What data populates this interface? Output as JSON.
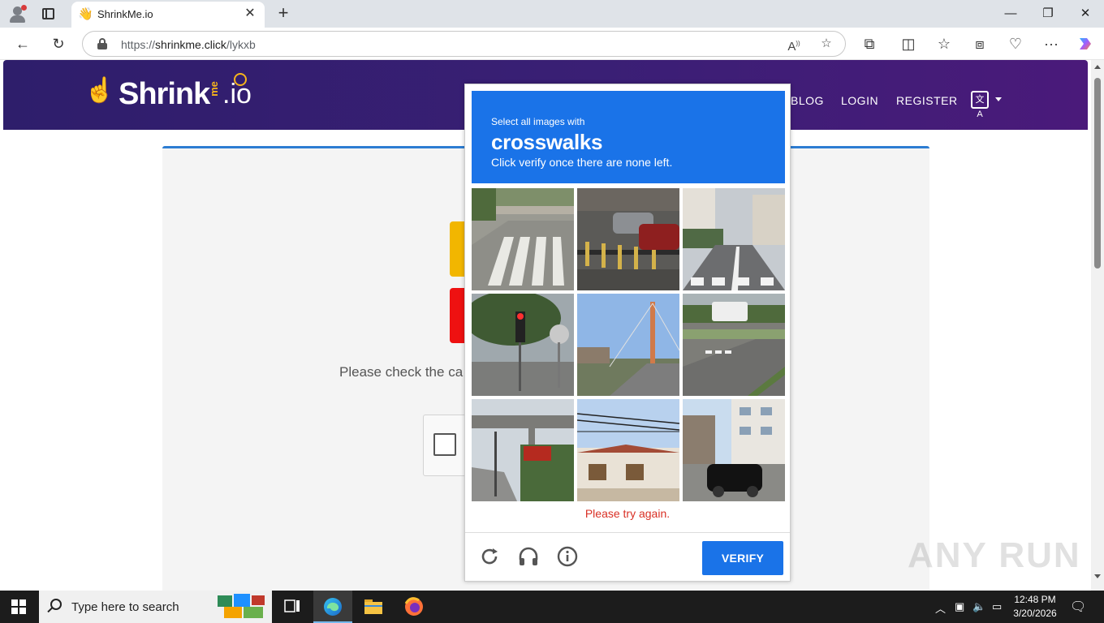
{
  "browser": {
    "tab_title": "ShrinkMe.io",
    "tab_favicon": "👋",
    "url_prefix": "https://",
    "url_host": "shrinkme.click",
    "url_path": "/lykxb"
  },
  "site": {
    "logo_text": "Shrink",
    "logo_me": "me",
    "logo_io": ".io",
    "nav": [
      "BLOG",
      "LOGIN",
      "REGISTER"
    ],
    "lang_icon_text": "文A"
  },
  "page": {
    "check_text": "Please check the ca"
  },
  "captcha": {
    "instruction_prefix": "Select all images with",
    "target": "crosswalks",
    "instruction_suffix": "Click verify once there are none left.",
    "tiles": [
      "crosswalk-street",
      "cars-parking-bollards",
      "bikes-road-crosswalk",
      "traffic-light-trees",
      "cable-bridge-road",
      "bus-road-crossing",
      "overpass-tractor",
      "house-power-lines",
      "black-car-building"
    ],
    "error": "Please try again.",
    "verify_label": "VERIFY"
  },
  "watermark": "ANY RUN",
  "taskbar": {
    "search_placeholder": "Type here to search",
    "time": "12:48 PM",
    "date": "3/20/2026"
  },
  "colors": {
    "header_start": "#2e1e6b",
    "header_end": "#4a1a7a",
    "captcha_blue": "#1a73e8",
    "error_red": "#d93025",
    "logo_yellow": "#f6b41c"
  }
}
